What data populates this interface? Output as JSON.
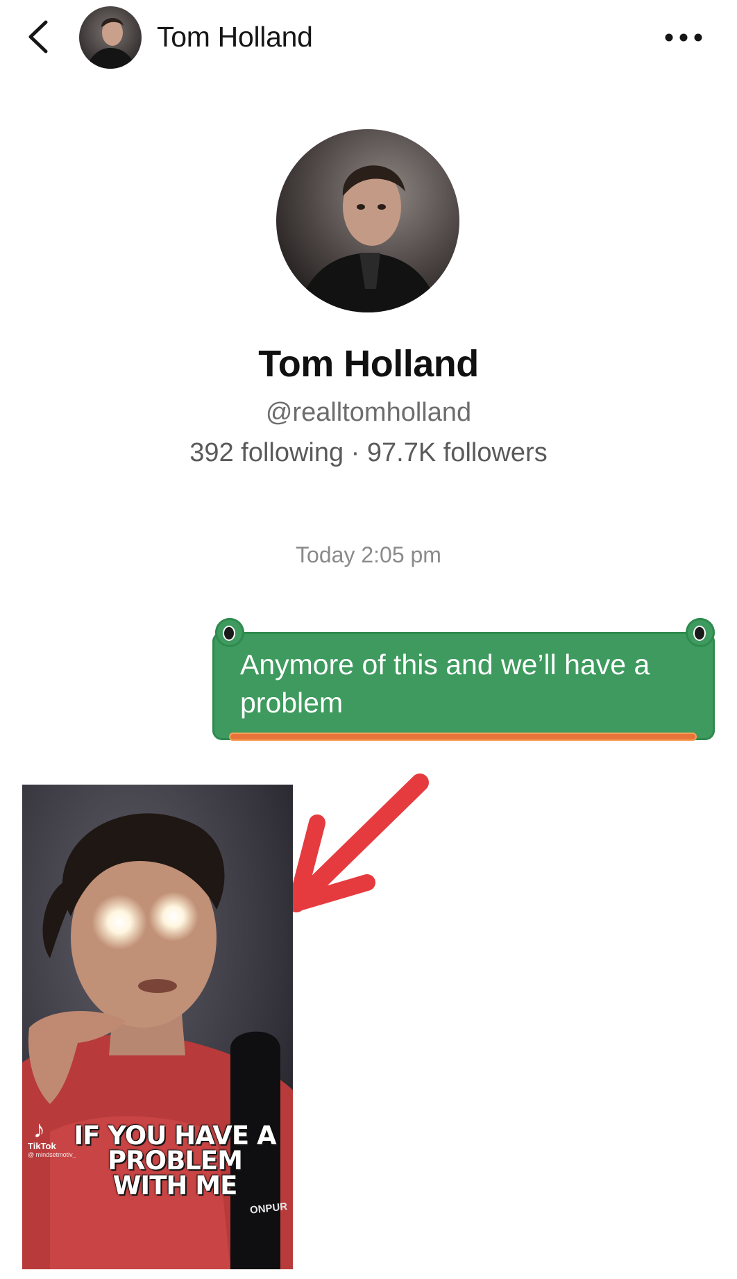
{
  "header": {
    "contact_name": "Tom Holland",
    "back_icon": "chevron-left-icon",
    "more_icon": "more-dots-icon"
  },
  "profile": {
    "name": "Tom Holland",
    "handle": "@realltomholland",
    "stats": "392 following · 97.7K followers"
  },
  "conversation": {
    "timestamp": "Today 2:05 pm",
    "messages": [
      {
        "sender": "me",
        "text": "Anymore of this and we’ll have a problem",
        "color": "#3e9a5e"
      }
    ],
    "shared_video": {
      "watermark_label": "TikTok",
      "watermark_user": "@ mindsetmotiv_",
      "caption": "IF YOU HAVE A PROBLEM WITH ME",
      "overlay_logo": "ONPUR"
    }
  },
  "colors": {
    "bubble": "#3e9a5e",
    "underline": "#e8743a",
    "arrow": "#e53b3f",
    "timestamp": "#8a8a8a"
  }
}
